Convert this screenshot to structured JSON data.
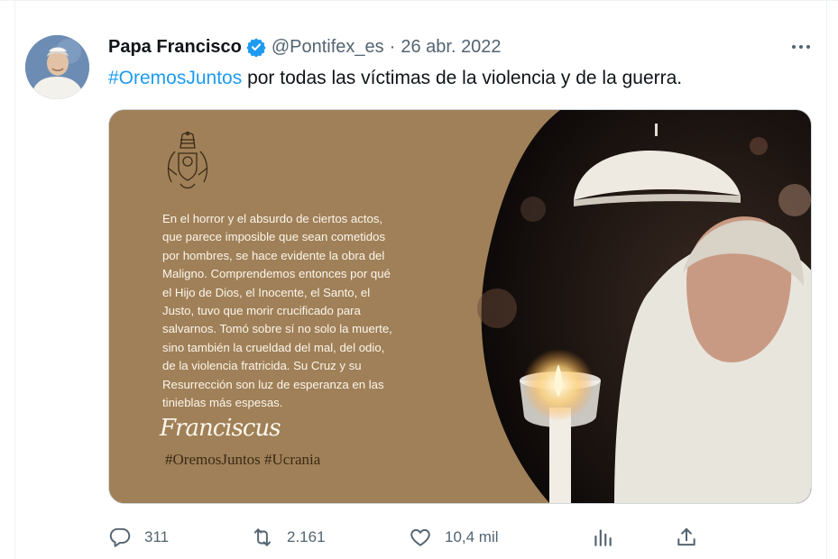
{
  "author": {
    "display_name": "Papa Francisco",
    "handle": "@Pontifex_es",
    "separator": "·",
    "date": "26 abr. 2022",
    "verified": true
  },
  "tweet": {
    "hashtag": "#OremosJuntos",
    "text": " por todas las víctimas de la violencia y de la guerra."
  },
  "media": {
    "quote": "En el horror y el absurdo de ciertos actos,\nque parece imposible que sean cometidos\npor hombres, se hace evidente la obra del\nMaligno. Comprendemos entonces por qué\nel Hijo de Dios, el Inocente, el Santo, el\nJusto, tuvo que morir crucificado para\nsalvarnos. Tomó sobre sí no solo la muerte,\nsino también la crueldad del mal, del odio,\nde la violencia fratricida. Su Cruz y su\nResurrección son luz de esperanza en las\ntinieblas más espesas.",
    "signature": "Franciscus",
    "hashtags": "#OremosJuntos #Ucrania",
    "panel_color": "#a08058"
  },
  "actions": {
    "replies": "311",
    "retweets": "2.161",
    "likes": "10,4 mil"
  },
  "colors": {
    "accent": "#1d9bf0",
    "secondary_text": "#536471",
    "primary_text": "#0f1419"
  },
  "icons": [
    "verified-badge-icon",
    "more-icon",
    "reply-icon",
    "retweet-icon",
    "like-icon",
    "analytics-icon",
    "share-icon"
  ]
}
